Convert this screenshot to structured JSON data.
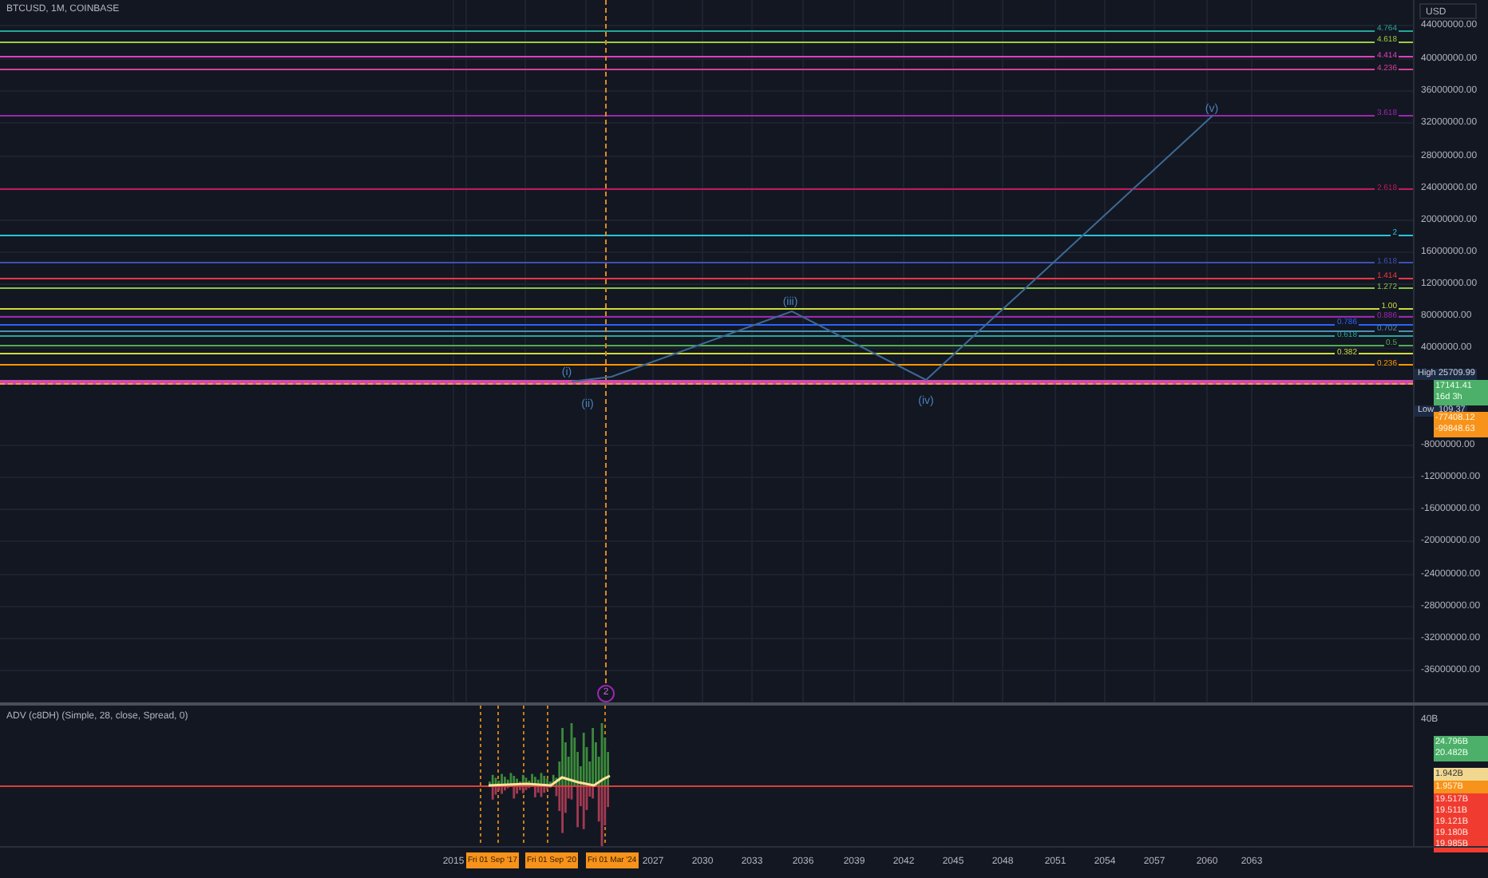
{
  "header": {
    "symbol": "BTCUSD, 1M, COINBASE",
    "currency": "USD"
  },
  "fib_levels": [
    {
      "label": "4.764",
      "color": "#26a69a"
    },
    {
      "label": "4.618",
      "color": "#9ccc3c"
    },
    {
      "label": "4.414",
      "color": "#e040c0"
    },
    {
      "label": "4.236",
      "color": "#d6409a"
    },
    {
      "label": "3.618",
      "color": "#9c27b0"
    },
    {
      "label": "2.618",
      "color": "#c2185b"
    },
    {
      "label": "2",
      "color": "#26c6da"
    },
    {
      "label": "1.618",
      "color": "#3f51b5"
    },
    {
      "label": "1.414",
      "color": "#f23645"
    },
    {
      "label": "1.272",
      "color": "#8bc34a"
    },
    {
      "label": "1.00",
      "color": "#cddc39"
    },
    {
      "label": "0.886",
      "color": "#9c27b0"
    },
    {
      "label": "0.786",
      "color": "#2962ff"
    },
    {
      "label": "0.702",
      "color": "#4b8fb0"
    },
    {
      "label": "0.618",
      "color": "#26a69a"
    },
    {
      "label": "0.5",
      "color": "#4caf50"
    },
    {
      "label": "0.382",
      "color": "#cddc39"
    },
    {
      "label": "0.236",
      "color": "#ff9800"
    }
  ],
  "price_axis": [
    "44000000.00",
    "40000000.00",
    "36000000.00",
    "32000000.00",
    "28000000.00",
    "24000000.00",
    "20000000.00",
    "16000000.00",
    "12000000.00",
    "8000000.00",
    "4000000.00",
    "-8000000.00",
    "-12000000.00",
    "-16000000.00",
    "-20000000.00",
    "-24000000.00",
    "-28000000.00",
    "-32000000.00",
    "-36000000.00"
  ],
  "price_tags": [
    {
      "kind": "high",
      "label": "High",
      "value": "25709.99"
    },
    {
      "kind": "last",
      "lines": [
        "17141.41",
        "16d 3h"
      ]
    },
    {
      "kind": "low",
      "label": "Low",
      "value": "109.37"
    },
    {
      "kind": "alert",
      "lines": [
        "-77408.12",
        "-99848.63"
      ]
    }
  ],
  "waves": [
    "(i)",
    "(ii)",
    "(iii)",
    "(iv)",
    "(v)"
  ],
  "event_marker": "2",
  "indicator": {
    "title": "ADV (c8DH) (Simple, 28, close, Spread, 0)",
    "axis": "40B",
    "tags": [
      {
        "kind": "up",
        "lines": [
          "24.796B",
          "20.482B"
        ]
      },
      {
        "kind": "mid",
        "lines": [
          "1.942B"
        ]
      },
      {
        "kind": "base",
        "lines": [
          "1.957B"
        ]
      },
      {
        "kind": "down",
        "lines": [
          "19.517B",
          "19.511B",
          "19.121B",
          "19.180B",
          "19.985B"
        ]
      }
    ]
  },
  "time_axis": [
    {
      "kind": "year",
      "label": "2015"
    },
    {
      "kind": "tag",
      "label": "Fri 01 Sep '17"
    },
    {
      "kind": "tag",
      "label": "Fri 01 Sep '20"
    },
    {
      "kind": "tag",
      "label": "Fri 01 Mar '24"
    },
    {
      "kind": "year",
      "label": "2027"
    },
    {
      "kind": "year",
      "label": "2030"
    },
    {
      "kind": "year",
      "label": "2033"
    },
    {
      "kind": "year",
      "label": "2036"
    },
    {
      "kind": "year",
      "label": "2039"
    },
    {
      "kind": "year",
      "label": "2042"
    },
    {
      "kind": "year",
      "label": "2045"
    },
    {
      "kind": "year",
      "label": "2048"
    },
    {
      "kind": "year",
      "label": "2051"
    },
    {
      "kind": "year",
      "label": "2054"
    },
    {
      "kind": "year",
      "label": "2057"
    },
    {
      "kind": "year",
      "label": "2060"
    },
    {
      "kind": "year",
      "label": "2063"
    }
  ]
}
